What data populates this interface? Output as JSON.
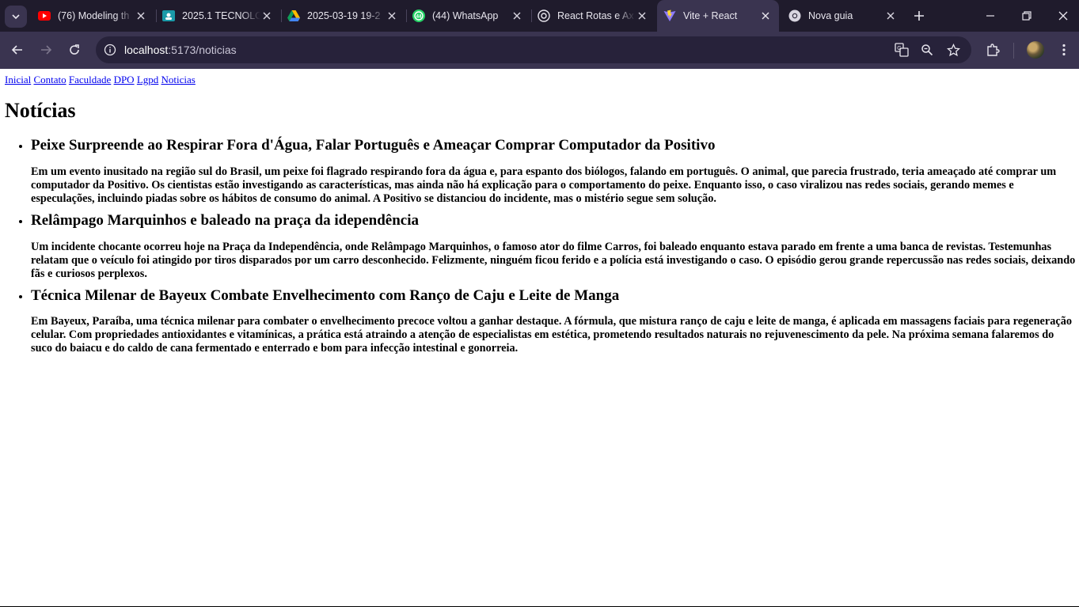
{
  "browser": {
    "tabs": [
      {
        "title": "(76) Modeling th",
        "icon": "youtube-icon"
      },
      {
        "title": "2025.1 TECNOLO",
        "icon": "classroom-icon"
      },
      {
        "title": "2025-03-19 19-2",
        "icon": "drive-icon"
      },
      {
        "title": "(44) WhatsApp",
        "icon": "whatsapp-icon"
      },
      {
        "title": "React Rotas e Ax",
        "icon": "chatgpt-icon"
      },
      {
        "title": "Vite + React",
        "icon": "vite-icon"
      },
      {
        "title": "Nova guia",
        "icon": "chrome-icon"
      }
    ],
    "active_tab_index": 5,
    "address": {
      "host": "localhost",
      "rest": ":5173/noticias"
    },
    "accent": "#3a3450"
  },
  "nav": {
    "links": [
      "Inicial",
      "Contato",
      "Faculdade",
      "DPO",
      "Lgpd",
      "Noticias"
    ]
  },
  "page": {
    "title": "Notícias",
    "articles": [
      {
        "title": "Peixe Surpreende ao Respirar Fora d'Água, Falar Português e Ameaçar Comprar Computador da Positivo",
        "body": "Em um evento inusitado na região sul do Brasil, um peixe foi flagrado respirando fora da água e, para espanto dos biólogos, falando em português. O animal, que parecia frustrado, teria ameaçado até comprar um computador da Positivo. Os cientistas estão investigando as características, mas ainda não há explicação para o comportamento do peixe. Enquanto isso, o caso viralizou nas redes sociais, gerando memes e especulações, incluindo piadas sobre os hábitos de consumo do animal. A Positivo se distanciou do incidente, mas o mistério segue sem solução."
      },
      {
        "title": "Relâmpago Marquinhos e baleado na praça da idependência",
        "body": "Um incidente chocante ocorreu hoje na Praça da Independência, onde Relâmpago Marquinhos, o famoso ator do filme Carros, foi baleado enquanto estava parado em frente a uma banca de revistas. Testemunhas relatam que o veículo foi atingido por tiros disparados por um carro desconhecido. Felizmente, ninguém ficou ferido e a polícia está investigando o caso. O episódio gerou grande repercussão nas redes sociais, deixando fãs e curiosos perplexos."
      },
      {
        "title": "Técnica Milenar de Bayeux Combate Envelhecimento com Ranço de Caju e Leite de Manga",
        "body": "Em Bayeux, Paraíba, uma técnica milenar para combater o envelhecimento precoce voltou a ganhar destaque. A fórmula, que mistura ranço de caju e leite de manga, é aplicada em massagens faciais para regeneração celular. Com propriedades antioxidantes e vitamínicas, a prática está atraindo a atenção de especialistas em estética, prometendo resultados naturais no rejuvenescimento da pele. Na próxima semana falaremos do suco do baiacu e do caldo de cana fermentado e enterrado e bom para infecção intestinal e gonorreia."
      }
    ]
  }
}
